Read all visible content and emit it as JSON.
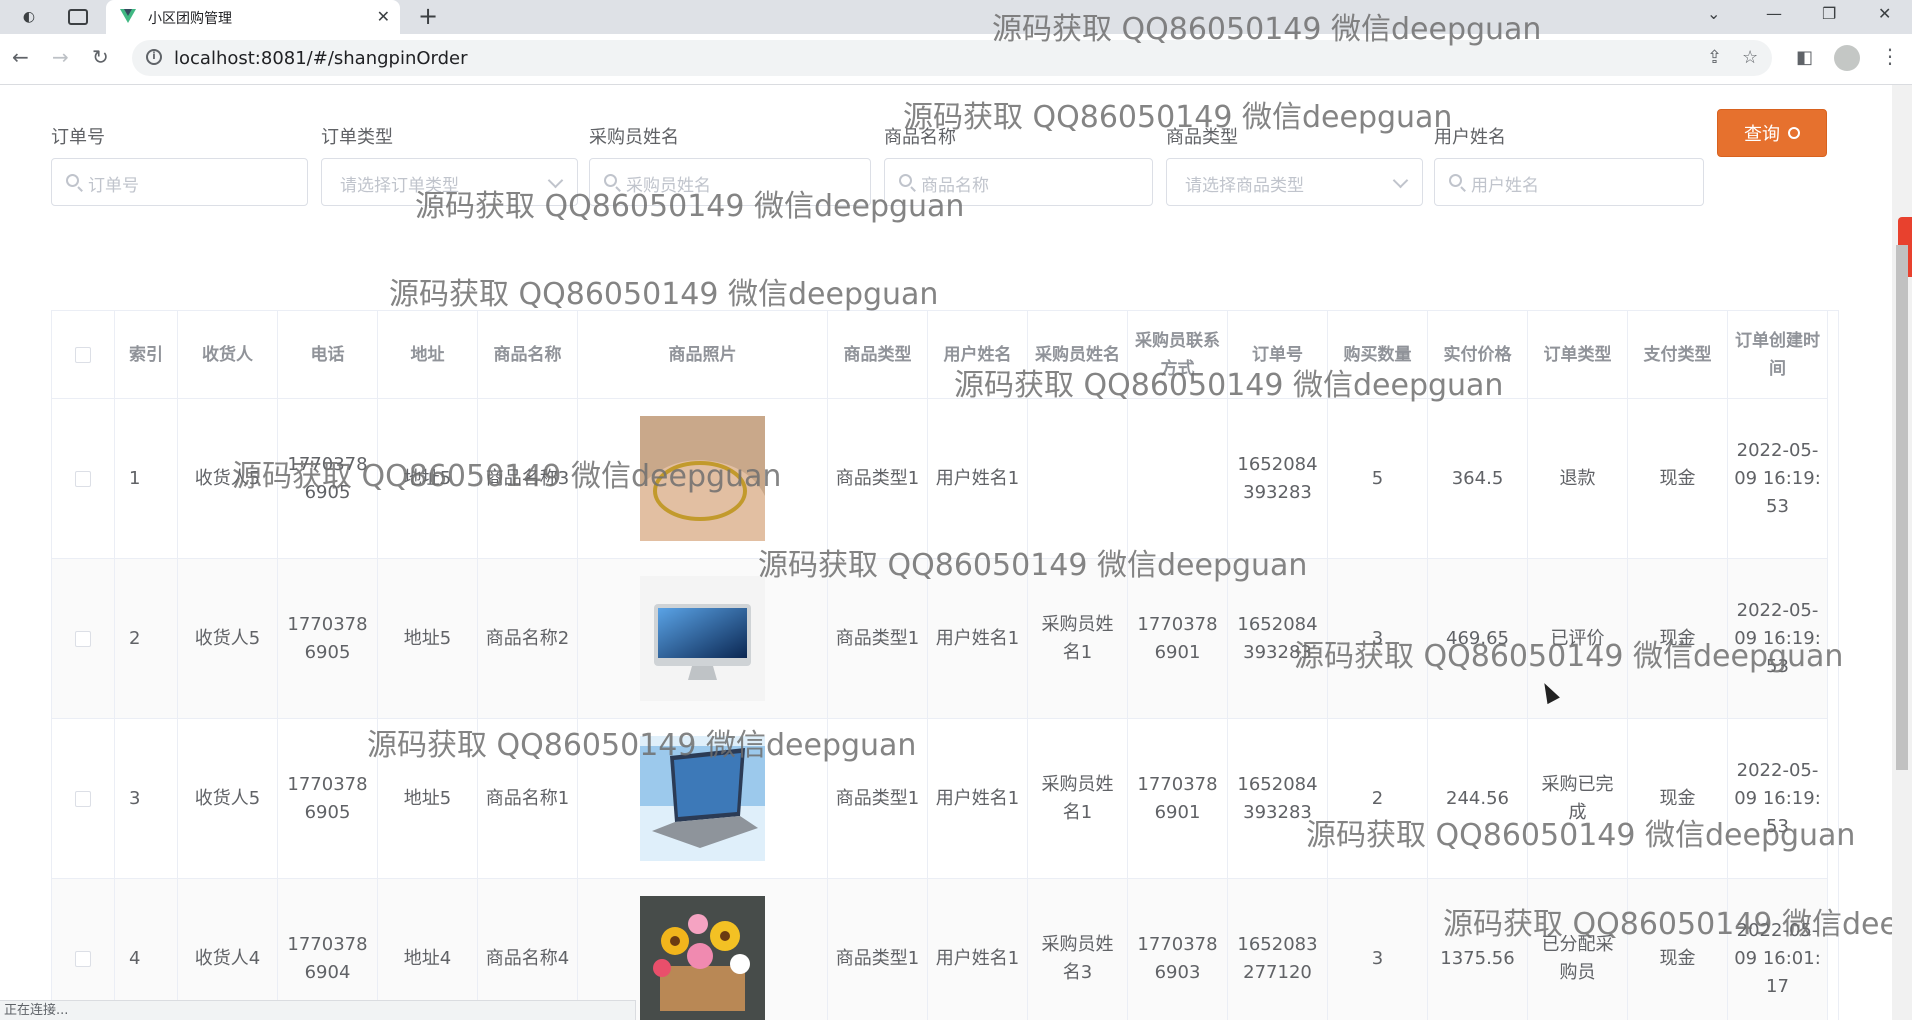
{
  "browser": {
    "tab_title": "小区团购管理",
    "url": "localhost:8081/#/shangpinOrder",
    "status_text": "正在连接..."
  },
  "colors": {
    "accent": "#e6712e",
    "vue_green": "#41b883",
    "vue_dark": "#35495e"
  },
  "search_form": {
    "fields": [
      {
        "label": "订单号",
        "placeholder": "订单号",
        "type": "input"
      },
      {
        "label": "订单类型",
        "placeholder": "请选择订单类型",
        "type": "select"
      },
      {
        "label": "采购员姓名",
        "placeholder": "采购员姓名",
        "type": "input"
      },
      {
        "label": "商品名称",
        "placeholder": "商品名称",
        "type": "input"
      },
      {
        "label": "商品类型",
        "placeholder": "请选择商品类型",
        "type": "select"
      },
      {
        "label": "用户姓名",
        "placeholder": "用户姓名",
        "type": "input"
      }
    ],
    "query_button": "查询"
  },
  "table": {
    "headers": [
      "索引",
      "收货人",
      "电话",
      "地址",
      "商品名称",
      "商品照片",
      "商品类型",
      "用户姓名",
      "采购员姓名",
      "采购员联系方式",
      "订单号",
      "购买数量",
      "实付价格",
      "订单类型",
      "支付类型",
      "订单创建时间"
    ],
    "rows": [
      {
        "index": "1",
        "receiver": "收货人5",
        "phone": "17703786905",
        "address": "地址5",
        "product_name": "商品名称3",
        "photo_icon": "ring-photo",
        "product_type": "商品类型1",
        "user_name": "用户姓名1",
        "buyer_name": "",
        "buyer_contact": "",
        "order_no": "1652084393283",
        "quantity": "5",
        "paid_price": "364.5",
        "order_type": "退款",
        "pay_type": "现金",
        "created_at": "2022-05-09 16:19:53"
      },
      {
        "index": "2",
        "receiver": "收货人5",
        "phone": "17703786905",
        "address": "地址5",
        "product_name": "商品名称2",
        "photo_icon": "imac-photo",
        "product_type": "商品类型1",
        "user_name": "用户姓名1",
        "buyer_name": "采购员姓名1",
        "buyer_contact": "17703786901",
        "order_no": "1652084393283",
        "quantity": "3",
        "paid_price": "469.65",
        "order_type": "已评价",
        "pay_type": "现金",
        "created_at": "2022-05-09 16:19:53"
      },
      {
        "index": "3",
        "receiver": "收货人5",
        "phone": "17703786905",
        "address": "地址5",
        "product_name": "商品名称1",
        "photo_icon": "laptop-photo",
        "product_type": "商品类型1",
        "user_name": "用户姓名1",
        "buyer_name": "采购员姓名1",
        "buyer_contact": "17703786901",
        "order_no": "1652084393283",
        "quantity": "2",
        "paid_price": "244.56",
        "order_type": "采购已完成",
        "pay_type": "现金",
        "created_at": "2022-05-09 16:19:53"
      },
      {
        "index": "4",
        "receiver": "收货人4",
        "phone": "17703786904",
        "address": "地址4",
        "product_name": "商品名称4",
        "photo_icon": "flowers-photo",
        "product_type": "商品类型1",
        "user_name": "用户姓名1",
        "buyer_name": "采购员姓名3",
        "buyer_contact": "17703786903",
        "order_no": "1652083277120",
        "quantity": "3",
        "paid_price": "1375.56",
        "order_type": "已分配采购员",
        "pay_type": "现金",
        "created_at": "2022-05-09 16:01:17"
      }
    ]
  },
  "watermark_text": "源码获取 QQ86050149 微信deepguan"
}
